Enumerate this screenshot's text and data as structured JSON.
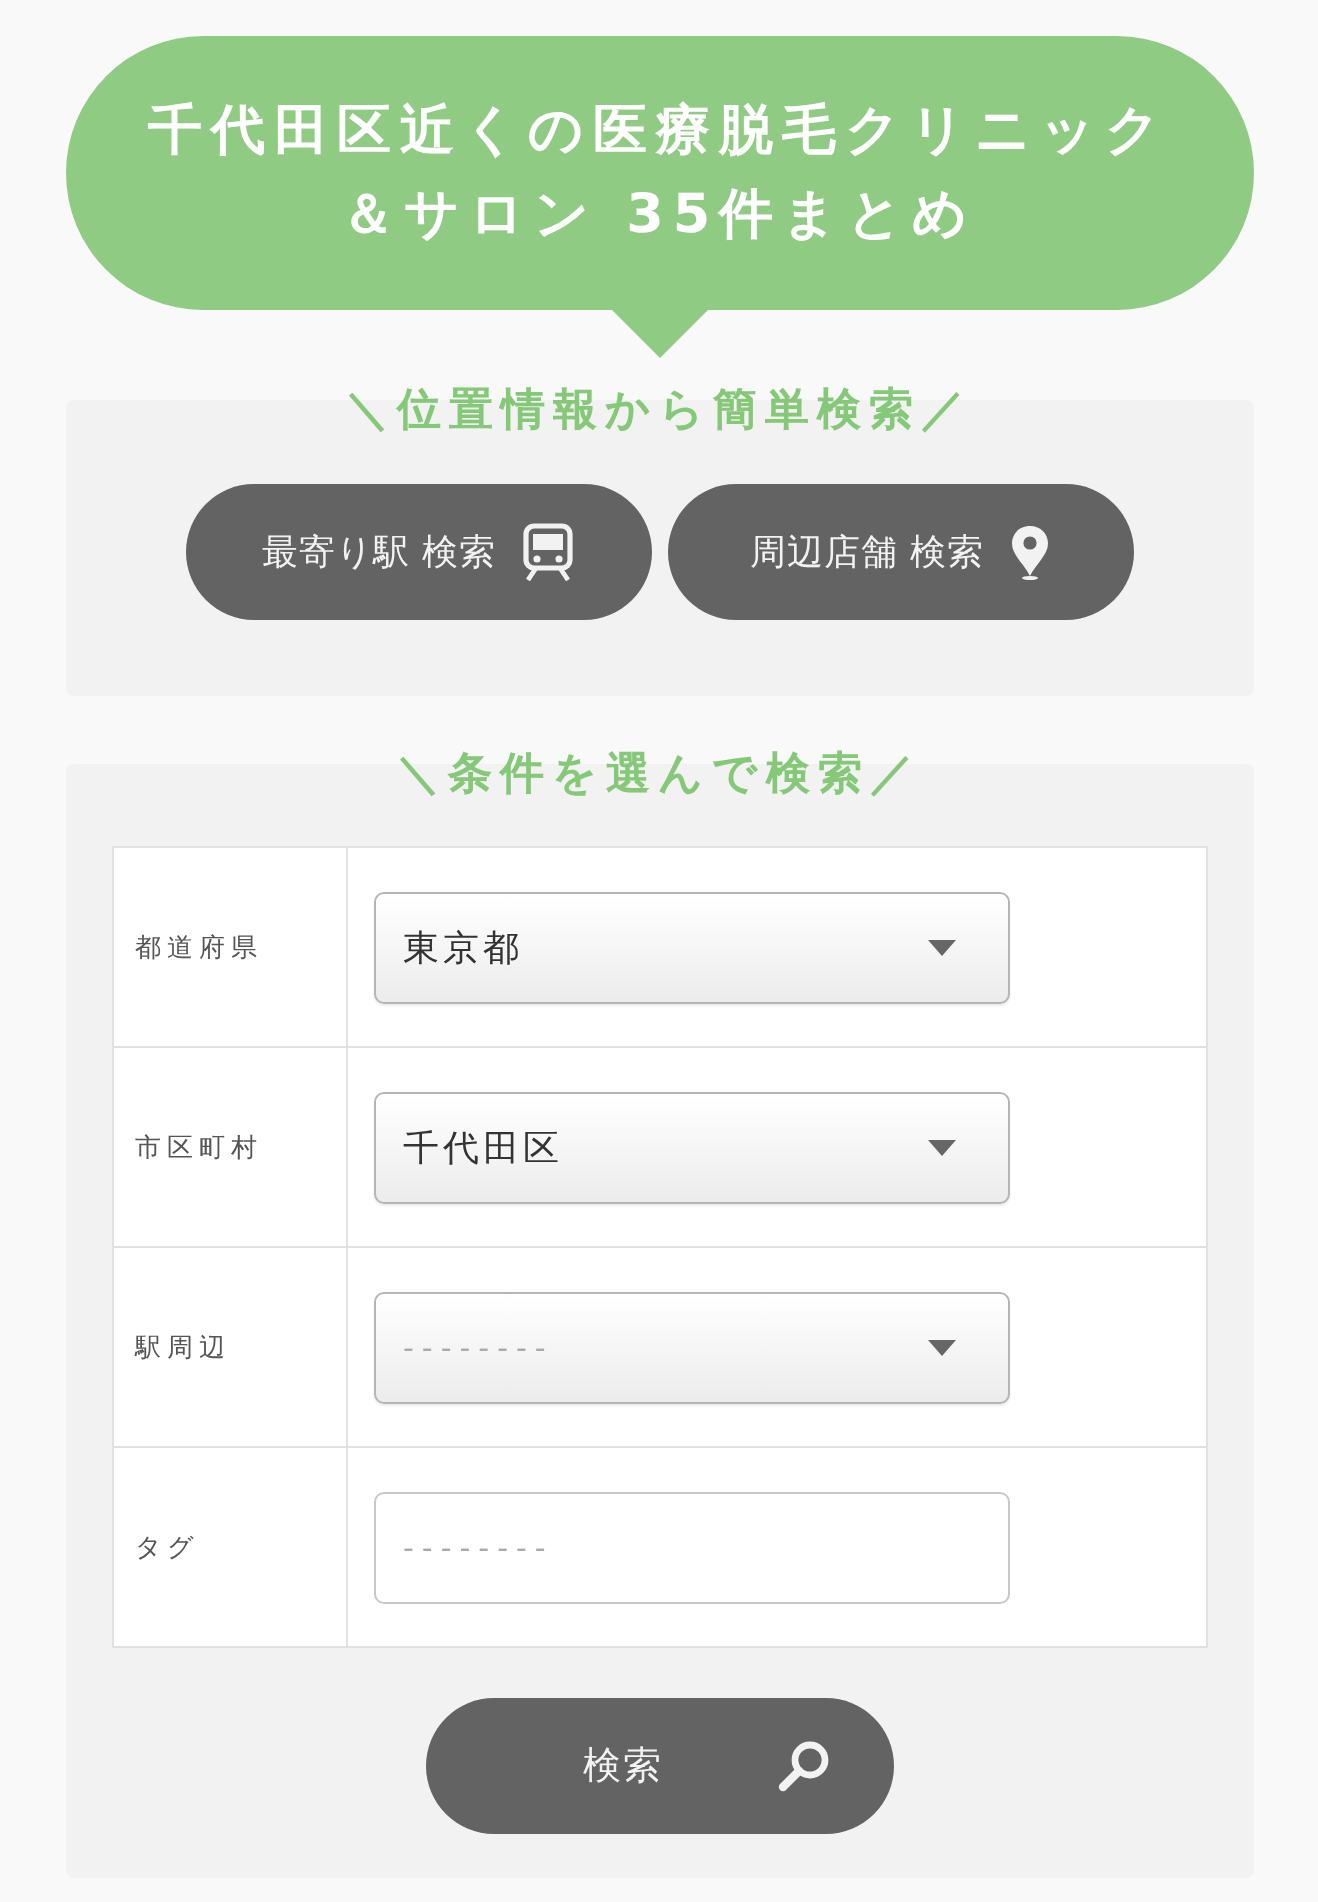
{
  "header": {
    "title_lines": [
      "千代田区近くの医療脱毛クリニック",
      "＆サロン 35件まとめ"
    ]
  },
  "location_search": {
    "heading": "＼位置情報から簡単検索／",
    "buttons": [
      {
        "label": "最寄り駅 検索",
        "kind": "station"
      },
      {
        "label": "周辺店舗 検索",
        "kind": "nearby"
      }
    ]
  },
  "condition_search": {
    "heading": "＼条件を選んで検索／",
    "fields": [
      {
        "label": "都道府県",
        "kind": "select",
        "value": "東京都"
      },
      {
        "label": "市区町村",
        "kind": "select",
        "value": "千代田区"
      },
      {
        "label": "駅周辺",
        "kind": "select",
        "placeholder": "--------"
      },
      {
        "label": "タグ",
        "kind": "text",
        "placeholder": "--------"
      }
    ],
    "submit": {
      "label": "検索"
    }
  }
}
